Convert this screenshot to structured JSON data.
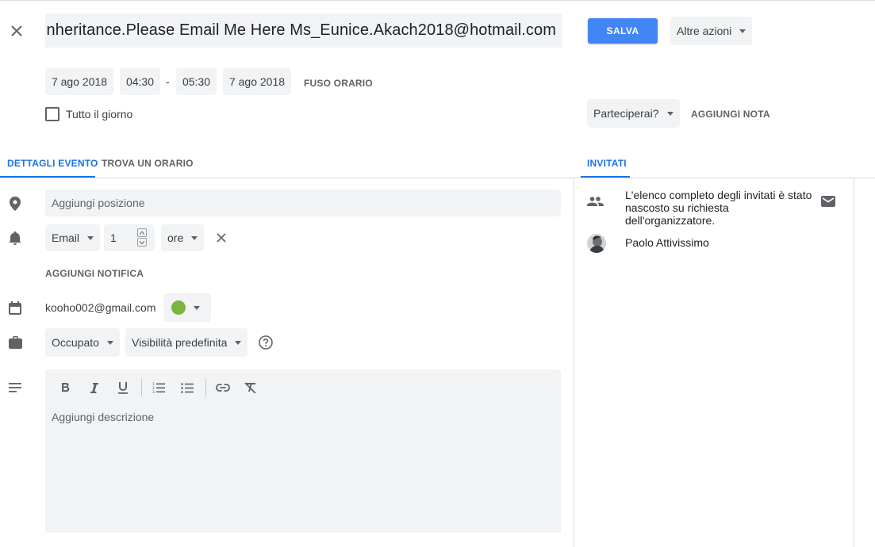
{
  "header": {
    "title_value": "nheritance.Please Email Me Here   Ms_Eunice.Akach2018@hotmail.com",
    "save_label": "SALVA",
    "more_actions_label": "Altre azioni"
  },
  "datetime": {
    "start_date": "7 ago 2018",
    "start_time": "04:30",
    "separator": "-",
    "end_time": "05:30",
    "end_date": "7 ago 2018",
    "timezone_label": "FUSO ORARIO",
    "all_day_label": "Tutto il giorno",
    "all_day_checked": false
  },
  "rsvp": {
    "attending_label": "Parteciperai?",
    "add_note_label": "AGGIUNGI NOTA"
  },
  "tabs": {
    "details": "DETTAGLI EVENTO",
    "find_time": "TROVA UN ORARIO",
    "guests": "INVITATI"
  },
  "details": {
    "location_placeholder": "Aggiungi posizione",
    "notification": {
      "method": "Email",
      "amount": "1",
      "unit": "ore"
    },
    "add_notification_label": "AGGIUNGI NOTIFICA",
    "calendar_owner": "kooho002@gmail.com",
    "calendar_color": "#7cb342",
    "availability": "Occupato",
    "visibility": "Visibilità predefinita",
    "description_placeholder": "Aggiungi descrizione"
  },
  "guests": {
    "hidden_notice": "L'elenco completo degli invitati è stato nascosto su richiesta dell'organizzatore.",
    "items": [
      {
        "name": "Paolo Attivissimo"
      }
    ]
  },
  "colors": {
    "accent": "#1a73e8",
    "save_button": "#4285f4",
    "field_bg": "#f1f3f4"
  }
}
